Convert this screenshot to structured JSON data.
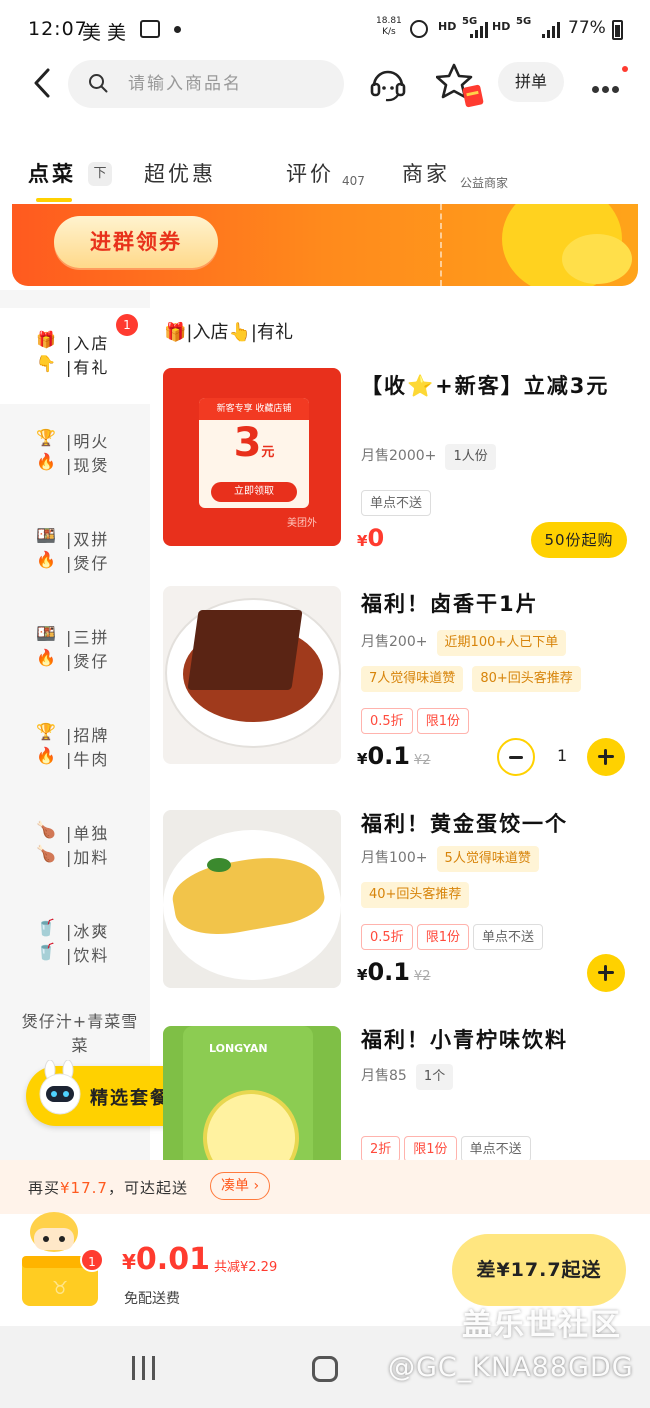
{
  "status_bar": {
    "time": "12:07",
    "carrier_label": "美 美",
    "net_speed_value": "18.81",
    "net_speed_unit": "K/s",
    "sim1": "HD",
    "sim1_net": "5G",
    "sim2": "HD",
    "sim2_net": "5G",
    "battery": "77%"
  },
  "header": {
    "search_placeholder": "请输入商品名",
    "group_order_label": "拼单",
    "icons": [
      "back-arrow-icon",
      "search-icon",
      "customer-service-icon",
      "favorite-star-icon",
      "more-icon"
    ]
  },
  "tabs": [
    {
      "label": "点菜",
      "badge": "下",
      "active": true
    },
    {
      "label": "超优惠",
      "sub": ""
    },
    {
      "label": "评价",
      "sub": "407"
    },
    {
      "label": "商家",
      "sub": "公益商家"
    }
  ],
  "banner": {
    "button_label": "进群领券"
  },
  "sidebar": {
    "categories": [
      {
        "icons": "🎁👇",
        "line1": "入店",
        "line2": "有礼",
        "badge": "1",
        "active": true
      },
      {
        "icons": "🏆🔥",
        "line1": "明火",
        "line2": "现煲"
      },
      {
        "icons": "🍱🔥",
        "line1": "双拼",
        "line2": "煲仔"
      },
      {
        "icons": "🍱🔥",
        "line1": "三拼",
        "line2": "煲仔"
      },
      {
        "icons": "🏆🔥",
        "line1": "招牌",
        "line2": "牛肉"
      },
      {
        "icons": "🍗🍗",
        "line1": "单独",
        "line2": "加料"
      },
      {
        "icons": "🥤🥤",
        "line1": "冰爽",
        "line2": "饮料"
      },
      {
        "single": "煲仔汁+青菜雪菜"
      }
    ],
    "featured_button": "精选套餐"
  },
  "section_title": "🎁|入店👆|有礼",
  "products": [
    {
      "name": "【收⭐+新客】立减3元",
      "sales": "月售2000+",
      "portion": "1人份",
      "coupon_text1": "新客专享 收藏店铺",
      "coupon_value": "3",
      "coupon_unit": "元",
      "coupon_cta": "立即领取",
      "coupon_source": "美团外",
      "tags": [
        "单点不送"
      ],
      "price_symbol": "¥",
      "price": "0",
      "min_purchase": "50份起购"
    },
    {
      "name": "福利！卤香干1片",
      "sales": "月售200+",
      "tag_hot": "近期100+人已下单",
      "tags_praise": [
        "7人觉得味道赞",
        "80+回头客推荐"
      ],
      "tags": [
        "0.5折",
        "限1份"
      ],
      "price_symbol": "¥",
      "price": "0.1",
      "original_price": "¥2",
      "quantity": "1"
    },
    {
      "name": "福利！黄金蛋饺一个",
      "sales": "月售100+",
      "tag_hot": "5人觉得味道赞",
      "tags_praise": [
        "40+回头客推荐"
      ],
      "tags": [
        "0.5折",
        "限1份",
        "单点不送"
      ],
      "price_symbol": "¥",
      "price": "0.1",
      "original_price": "¥2"
    },
    {
      "name": "福利！小青柠味饮料",
      "sales": "月售85",
      "portion": "1个",
      "tags": [
        "2折",
        "限1份",
        "单点不送"
      ],
      "brand_text": "LONGYAN"
    }
  ],
  "tip_bar": {
    "prefix": "再买",
    "amount": "¥17.7",
    "suffix": "，可达起送",
    "action": "凑单"
  },
  "cart": {
    "badge": "1",
    "currency": "¥",
    "total": "0.01",
    "saved": "共减¥2.29",
    "delivery_note": "免配送费",
    "checkout_label": "差¥17.7起送"
  },
  "watermark": {
    "line1": "盖乐世社区",
    "line2": "@GC_KNA88GDG"
  }
}
